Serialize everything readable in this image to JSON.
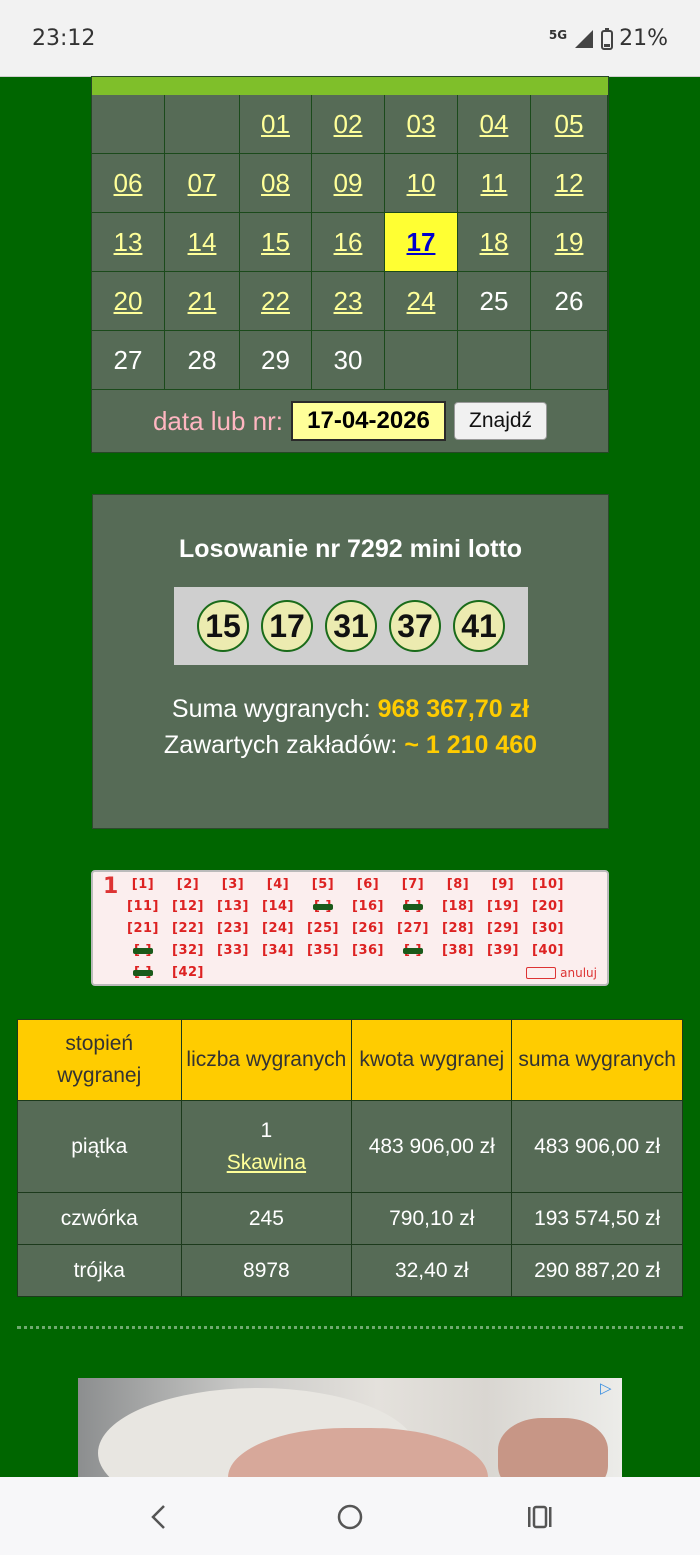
{
  "status": {
    "time": "23:12",
    "network": "5G",
    "battery": "21%"
  },
  "calendar": {
    "rows": [
      [
        {
          "t": ""
        },
        {
          "t": ""
        },
        {
          "t": "01",
          "link": true
        },
        {
          "t": "02",
          "link": true
        },
        {
          "t": "03",
          "link": true
        },
        {
          "t": "04",
          "link": true
        },
        {
          "t": "05",
          "link": true
        }
      ],
      [
        {
          "t": "06",
          "link": true
        },
        {
          "t": "07",
          "link": true
        },
        {
          "t": "08",
          "link": true
        },
        {
          "t": "09",
          "link": true
        },
        {
          "t": "10",
          "link": true
        },
        {
          "t": "11",
          "link": true
        },
        {
          "t": "12",
          "link": true
        }
      ],
      [
        {
          "t": "13",
          "link": true
        },
        {
          "t": "14",
          "link": true
        },
        {
          "t": "15",
          "link": true
        },
        {
          "t": "16",
          "link": true
        },
        {
          "t": "17",
          "today": true
        },
        {
          "t": "18",
          "link": true
        },
        {
          "t": "19",
          "link": true
        }
      ],
      [
        {
          "t": "20",
          "link": true
        },
        {
          "t": "21",
          "link": true
        },
        {
          "t": "22",
          "link": true
        },
        {
          "t": "23",
          "link": true
        },
        {
          "t": "24",
          "link": true
        },
        {
          "t": "25"
        },
        {
          "t": "26"
        }
      ],
      [
        {
          "t": "27"
        },
        {
          "t": "28"
        },
        {
          "t": "29"
        },
        {
          "t": "30"
        },
        {
          "t": ""
        },
        {
          "t": ""
        },
        {
          "t": ""
        }
      ]
    ],
    "search_label": "data lub nr:",
    "search_value": "17-04-2026",
    "search_button": "Znajdź"
  },
  "draw": {
    "title": "Losowanie nr 7292 mini lotto",
    "balls": [
      "15",
      "17",
      "31",
      "37",
      "41"
    ],
    "sum_label": "Suma wygranych:",
    "sum_value": "968 367,70 zł",
    "bets_label": "Zawartych zakładów:",
    "bets_value": "~ 1 210 460"
  },
  "coupon": {
    "index": "1",
    "numbers": [
      [
        "1",
        "2",
        "3",
        "4",
        "5",
        "6",
        "7",
        "8",
        "9",
        "10"
      ],
      [
        "11",
        "12",
        "13",
        "14",
        "15",
        "16",
        "17",
        "18",
        "19",
        "20"
      ],
      [
        "21",
        "22",
        "23",
        "24",
        "25",
        "26",
        "27",
        "28",
        "29",
        "30"
      ],
      [
        "31",
        "32",
        "33",
        "34",
        "35",
        "36",
        "37",
        "38",
        "39",
        "40"
      ],
      [
        "41",
        "42"
      ]
    ],
    "marked": [
      "15",
      "17",
      "31",
      "37",
      "41"
    ],
    "cancel_label": "anuluj"
  },
  "results": {
    "headers": [
      "stopień wygranej",
      "liczba wygranych",
      "kwota wygranej",
      "suma wygranych"
    ],
    "rows": [
      {
        "tier": "piątka",
        "count": "1",
        "place": "Skawina",
        "amount": "483 906,00 zł",
        "total": "483 906,00 zł"
      },
      {
        "tier": "czwórka",
        "count": "245",
        "amount": "790,10 zł",
        "total": "193 574,50 zł"
      },
      {
        "tier": "trójka",
        "count": "8978",
        "amount": "32,40 zł",
        "total": "290 887,20 zł"
      }
    ]
  },
  "ad": {
    "icon": "adchoices-icon"
  },
  "nav": {
    "back": "‹",
    "home": "○",
    "recents": "|||"
  }
}
